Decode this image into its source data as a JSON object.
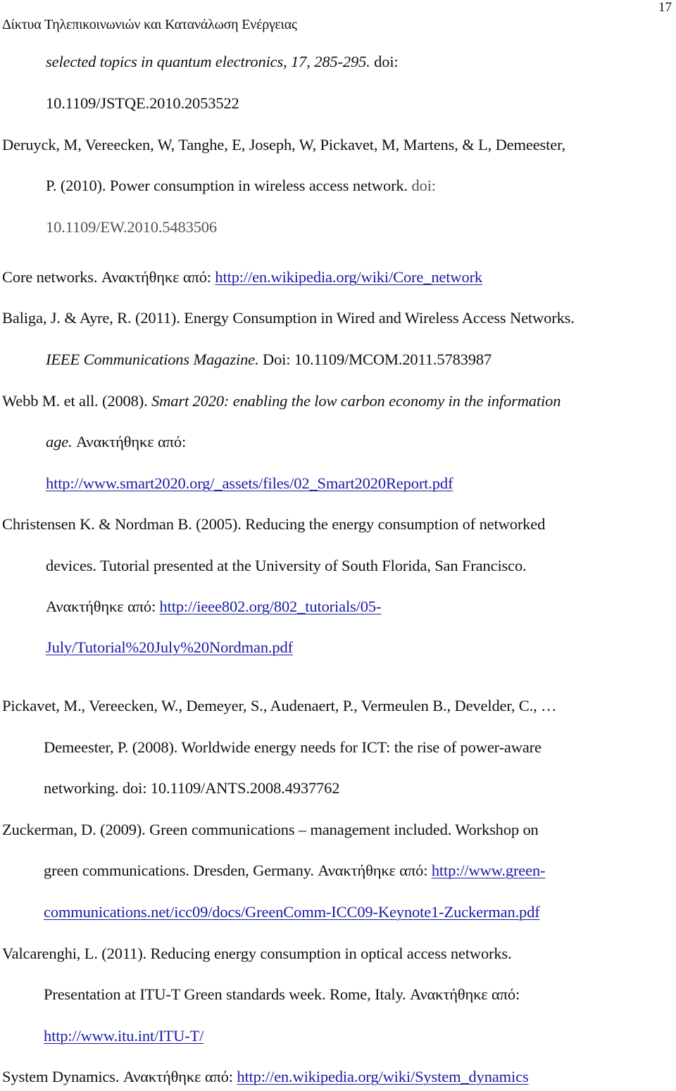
{
  "header": {
    "page_number": "17",
    "running_title": "Δίκτυα Τηλεπικοινωνιών και Κατανάλωση Ενέργειας"
  },
  "retrieved_label": "Ανακτήθηκε από:",
  "references": [
    {
      "id": "ref-continued",
      "lines": [
        {
          "italic": "selected topics in quantum electronics, 17, 285-295.",
          "text": "  doi:"
        },
        {
          "text": "10.1109/JSTQE.2010.2053522"
        }
      ]
    },
    {
      "id": "deruyck",
      "lines": [
        {
          "text": "Deruyck, M, Vereecken, W, Tanghe, E, Joseph, W, Pickavet, M, Martens, & L, Demeester,"
        },
        {
          "text": "P.  (2010).  Power consumption in wireless access network.",
          "gray": "  doi:"
        },
        {
          "gray": "10.1109/EW.2010.5483506"
        }
      ]
    },
    {
      "id": "core-networks",
      "lines": [
        {
          "text": "Core networks.  ",
          "link": "http://en.wikipedia.org/wiki/Core_network"
        }
      ]
    },
    {
      "id": "baliga",
      "lines": [
        {
          "text": "Baliga, J. & Ayre, R.  (2011).  Energy Consumption in Wired and Wireless Access Networks."
        },
        {
          "italic": "IEEE Communications Magazine.",
          "text": "  Doi: 10.1109/MCOM.2011.5783987"
        }
      ]
    },
    {
      "id": "webb",
      "lines": [
        {
          "text": "Webb M. et all. (2008).  ",
          "italic": "Smart 2020: enabling the low carbon economy in the information"
        },
        {
          "italic": "age.",
          "text": "  "
        },
        {
          "link": "http://www.smart2020.org/_assets/files/02_Smart2020Report.pdf"
        }
      ]
    },
    {
      "id": "christensen",
      "lines": [
        {
          "text": "Christensen K. & Nordman B.  (2005).  Reducing the energy consumption of networked"
        },
        {
          "text": "devices.  Tutorial presented at the University of South Florida, San Francisco."
        },
        {
          "link": "http://ieee802.org/802_tutorials/05-"
        },
        {
          "link": "July/Tutorial%20July%20Nordman.pdf"
        }
      ]
    },
    {
      "id": "pickavet",
      "lines": [
        {
          "text": "Pickavet, M., Vereecken, W., Demeyer, S., Audenaert, P., Vermeulen B., Develder, C., …"
        },
        {
          "text": "Demeester, P.  (2008).  Worldwide energy needs for ICT: the rise of power-aware"
        },
        {
          "text": "networking.  doi: 10.1109/ANTS.2008.4937762"
        }
      ]
    },
    {
      "id": "zuckerman",
      "lines": [
        {
          "text": "Zuckerman,  D.  (2009).  Green communications – management included.   Workshop on"
        },
        {
          "text": "green communications. Dresden, Germany.  ",
          "link": "http://www.green-"
        },
        {
          "link": "communications.net/icc09/docs/GreenComm-ICC09-Keynote1-Zuckerman.pdf"
        }
      ]
    },
    {
      "id": "valcarenghi",
      "lines": [
        {
          "text": "Valcarenghi, L.  (2011).  Reducing energy consumption in optical access networks."
        },
        {
          "text": "Presentation at ITU-T Green standards week.  Rome, Italy.  "
        },
        {
          "link": "http://www.itu.int/ITU-T/"
        }
      ]
    },
    {
      "id": "system-dynamics",
      "lines": [
        {
          "text": "System Dynamics.  ",
          "link": "http://en.wikipedia.org/wiki/System_dynamics"
        }
      ]
    }
  ]
}
